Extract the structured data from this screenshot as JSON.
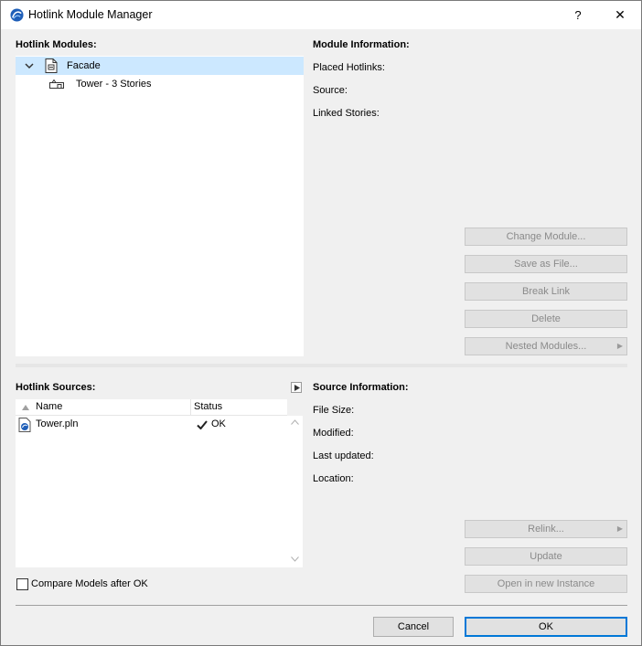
{
  "window": {
    "title": "Hotlink Module Manager",
    "help_label": "?",
    "close_label": "✕"
  },
  "modules": {
    "heading": "Hotlink Modules:",
    "items": [
      {
        "label": "Facade",
        "icon": "module-file-icon",
        "expanded": true,
        "selected": true
      },
      {
        "label": "Tower - 3 Stories",
        "icon": "linked-stories-icon"
      }
    ]
  },
  "module_info": {
    "heading": "Module Information:",
    "placed_hotlinks_label": "Placed Hotlinks:",
    "source_label": "Source:",
    "linked_stories_label": "Linked Stories:"
  },
  "module_buttons": {
    "change_module": "Change Module...",
    "save_as_file": "Save as File...",
    "break_link": "Break Link",
    "delete": "Delete",
    "nested_modules": "Nested Modules..."
  },
  "sources": {
    "heading": "Hotlink Sources:",
    "columns": {
      "name": "Name",
      "status": "Status"
    },
    "rows": [
      {
        "name": "Tower.pln",
        "status": "OK",
        "status_icon": "checkmark-icon"
      }
    ]
  },
  "source_info": {
    "heading": "Source Information:",
    "file_size_label": "File Size:",
    "modified_label": "Modified:",
    "last_updated_label": "Last updated:",
    "location_label": "Location:"
  },
  "source_buttons": {
    "relink": "Relink...",
    "update": "Update",
    "open_new_instance": "Open in new Instance"
  },
  "compare": {
    "label": "Compare Models after OK",
    "checked": false
  },
  "footer": {
    "cancel": "Cancel",
    "ok": "OK"
  },
  "colors": {
    "selection": "#cce8ff",
    "default_border": "#0078d7",
    "dialog_bg": "#f0f0f0"
  }
}
